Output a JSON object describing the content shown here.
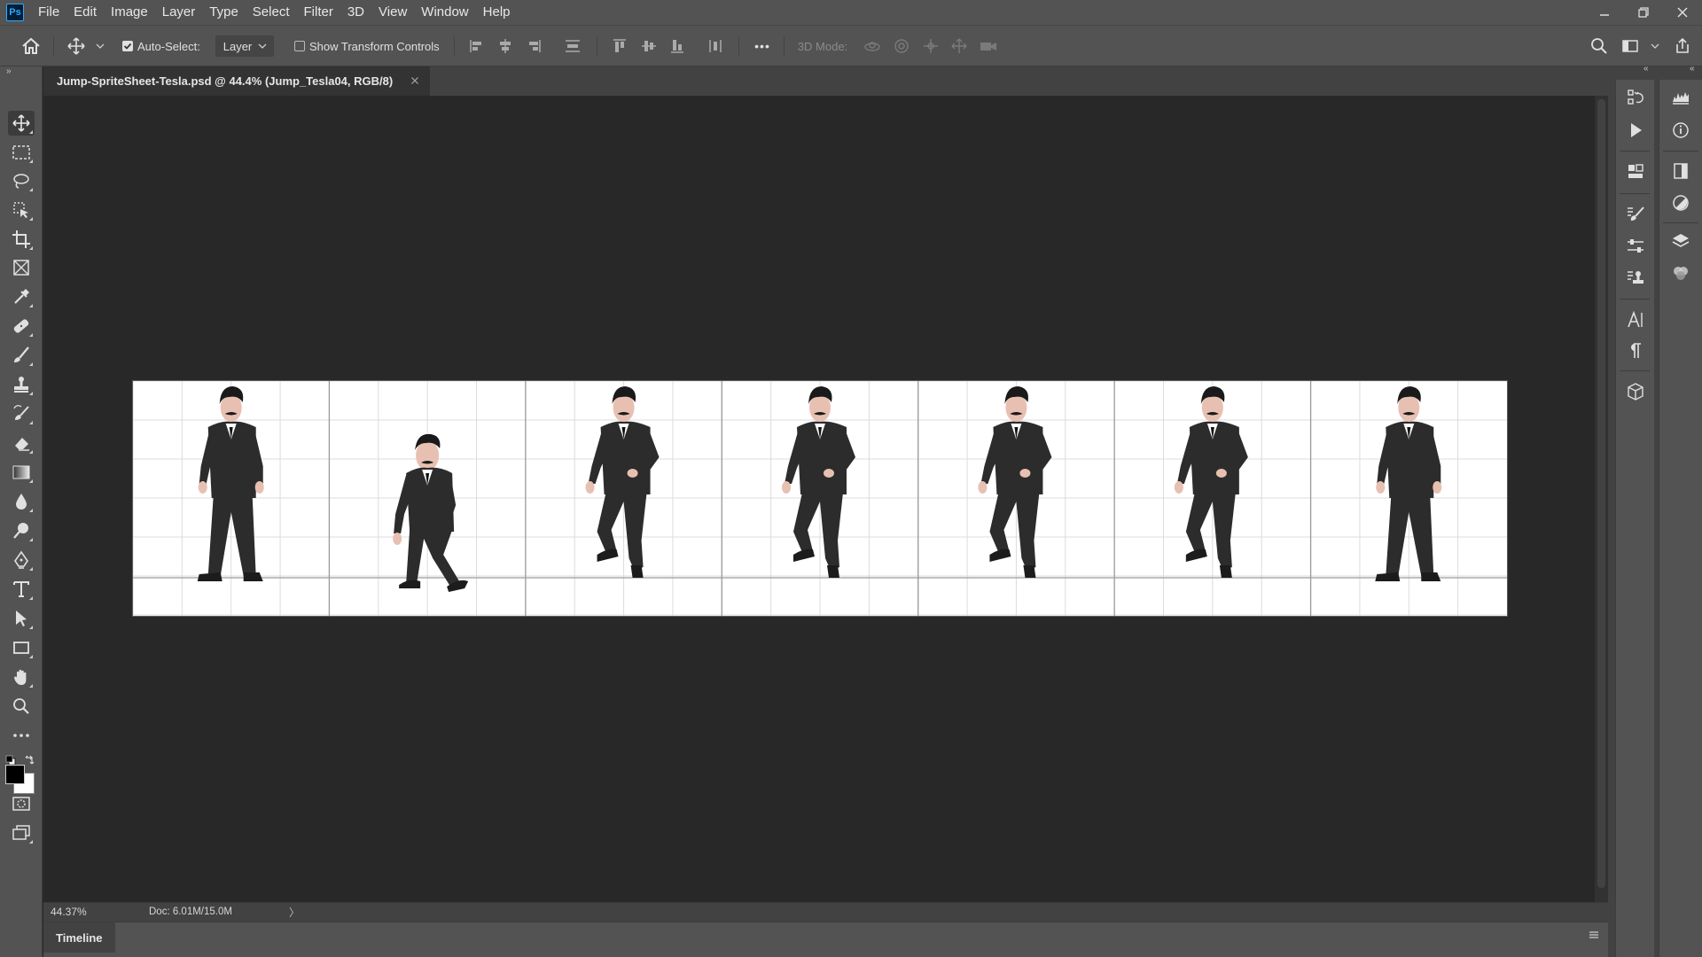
{
  "app": {
    "logo_text": "Ps"
  },
  "menu": [
    "File",
    "Edit",
    "Image",
    "Layer",
    "Type",
    "Select",
    "Filter",
    "3D",
    "View",
    "Window",
    "Help"
  ],
  "options_bar": {
    "auto_select_label": "Auto-Select:",
    "auto_select_checked": true,
    "auto_select_target": "Layer",
    "show_transform_controls_label": "Show Transform Controls",
    "show_transform_controls_checked": false,
    "three_d_mode_label": "3D Mode:",
    "more_label": "•••"
  },
  "document": {
    "tab_title": "Jump-SpriteSheet-Tesla.psd @ 44.4% (Jump_Tesla04, RGB/8)",
    "close_glyph": "×"
  },
  "status": {
    "zoom": "44.37%",
    "doc_size": "Doc: 6.01M/15.0M",
    "arrow": "〉"
  },
  "timeline": {
    "tab_label": "Timeline"
  },
  "sprite_sheet": {
    "frame_count": 7,
    "frames": [
      {
        "pose": "stand"
      },
      {
        "pose": "crouch"
      },
      {
        "pose": "jump"
      },
      {
        "pose": "jump"
      },
      {
        "pose": "jump"
      },
      {
        "pose": "jump"
      },
      {
        "pose": "stand"
      }
    ],
    "colors": {
      "suit": "#2c2c2c",
      "skin": "#e8c0b2",
      "hair": "#1a1a1a",
      "guides": "#9a9a9a",
      "grid": "#dcdcdc"
    }
  },
  "tools": [
    "move-tool",
    "rectangular-marquee-tool",
    "lasso-tool",
    "object-selection-tool",
    "crop-tool",
    "frame-tool",
    "eyedropper-tool",
    "spot-healing-tool",
    "brush-tool",
    "clone-stamp-tool",
    "history-brush-tool",
    "eraser-tool",
    "gradient-tool",
    "blur-tool",
    "dodge-tool",
    "pen-tool",
    "type-tool",
    "path-selection-tool",
    "rectangle-tool",
    "hand-tool",
    "zoom-tool",
    "edit-toolbar"
  ],
  "colors": {
    "foreground": "#000000",
    "background": "#ffffff",
    "chrome": "#535353",
    "canvas_bg": "#282828"
  }
}
